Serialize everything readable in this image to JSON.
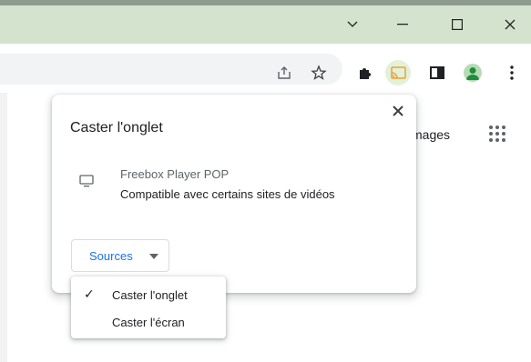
{
  "window": {
    "controls": {
      "tab_search_icon": "chevron-down",
      "minimize_icon": "minimize",
      "maximize_icon": "maximize",
      "close_icon": "close"
    },
    "titlebar_color": "#d3e3cd"
  },
  "toolbar": {
    "icons": [
      "share-icon",
      "star-icon",
      "extensions-icon",
      "cast-icon",
      "side-panel-icon",
      "profile-avatar",
      "more-icon"
    ],
    "cast_active_color": "#e3f1d9"
  },
  "page": {
    "images_link": "mages"
  },
  "cast_popup": {
    "title": "Caster l'onglet",
    "device": {
      "name": "Freebox Player POP",
      "description": "Compatible avec certains sites de vidéos"
    },
    "sources_button": "Sources",
    "accent_color": "#1a73e8"
  },
  "sources_menu": {
    "items": [
      {
        "label": "Caster l'onglet",
        "checked": true,
        "check_mark": "✓"
      },
      {
        "label": "Caster l'écran",
        "checked": false,
        "check_mark": ""
      }
    ]
  }
}
